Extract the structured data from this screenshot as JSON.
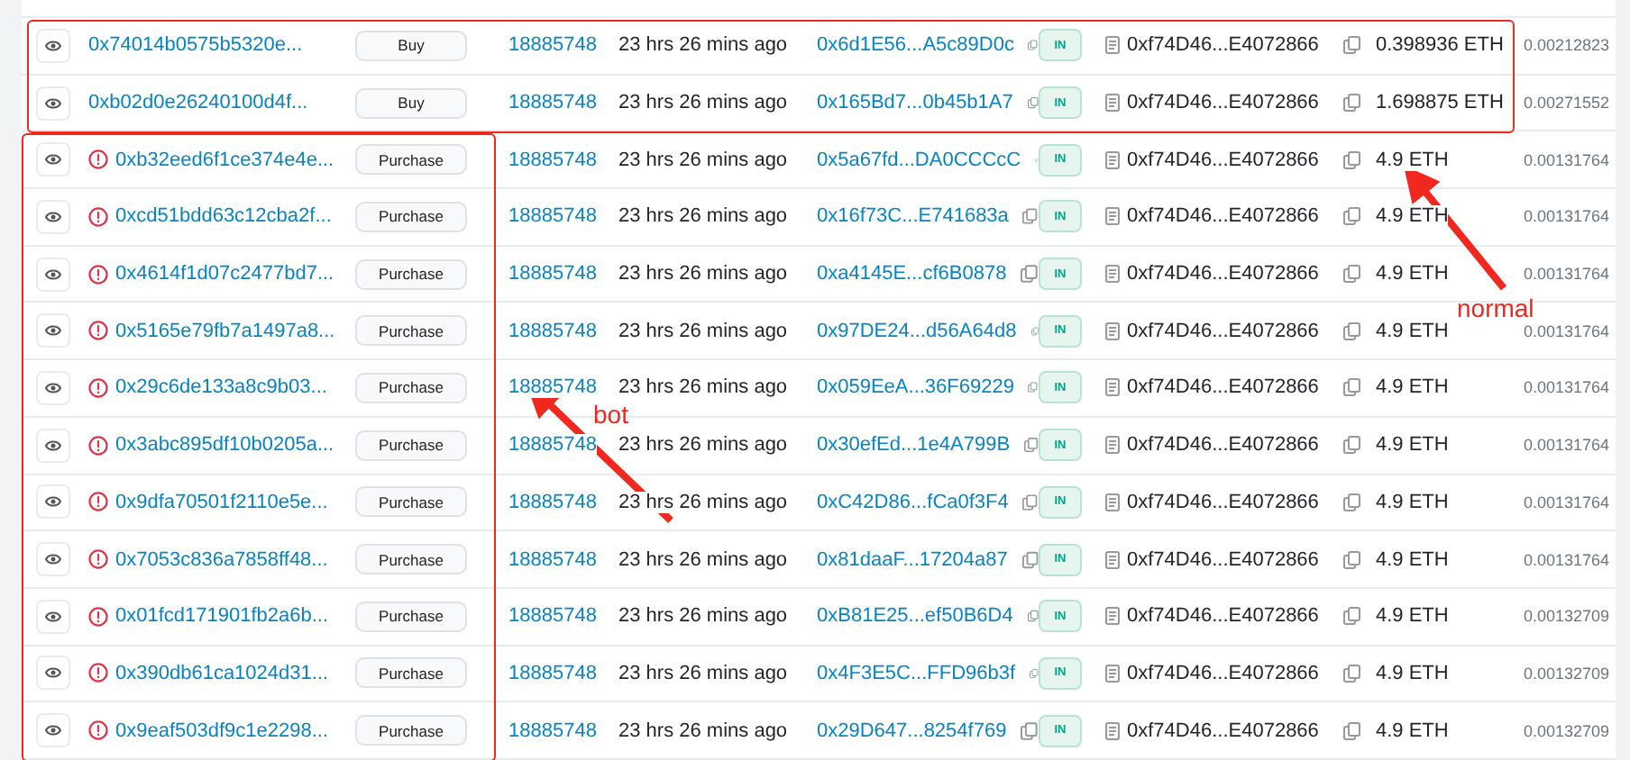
{
  "rows": [
    {
      "hash": "0x74014b0575b5320e...",
      "flagged": false,
      "method": "Buy",
      "block": "18885748",
      "age": "23 hrs 26 mins ago",
      "from": "0x6d1E56...A5c89D0c",
      "direction": "IN",
      "to": "0xf74D46...E4072866",
      "value": "0.398936 ETH",
      "fee": "0.00212823"
    },
    {
      "hash": "0xb02d0e26240100d4f...",
      "flagged": false,
      "method": "Buy",
      "block": "18885748",
      "age": "23 hrs 26 mins ago",
      "from": "0x165Bd7...0b45b1A7",
      "direction": "IN",
      "to": "0xf74D46...E4072866",
      "value": "1.698875 ETH",
      "fee": "0.00271552"
    },
    {
      "hash": "0xb32eed6f1ce374e4e...",
      "flagged": true,
      "method": "Purchase",
      "block": "18885748",
      "age": "23 hrs 26 mins ago",
      "from": "0x5a67fd...DA0CCCcC",
      "direction": "IN",
      "to": "0xf74D46...E4072866",
      "value": "4.9 ETH",
      "fee": "0.00131764"
    },
    {
      "hash": "0xcd51bdd63c12cba2f...",
      "flagged": true,
      "method": "Purchase",
      "block": "18885748",
      "age": "23 hrs 26 mins ago",
      "from": "0x16f73C...E741683a",
      "direction": "IN",
      "to": "0xf74D46...E4072866",
      "value": "4.9 ETH",
      "fee": "0.00131764"
    },
    {
      "hash": "0x4614f1d07c2477bd7...",
      "flagged": true,
      "method": "Purchase",
      "block": "18885748",
      "age": "23 hrs 26 mins ago",
      "from": "0xa4145E...cf6B0878",
      "direction": "IN",
      "to": "0xf74D46...E4072866",
      "value": "4.9 ETH",
      "fee": "0.00131764"
    },
    {
      "hash": "0x5165e79fb7a1497a8...",
      "flagged": true,
      "method": "Purchase",
      "block": "18885748",
      "age": "23 hrs 26 mins ago",
      "from": "0x97DE24...d56A64d8",
      "direction": "IN",
      "to": "0xf74D46...E4072866",
      "value": "4.9 ETH",
      "fee": "0.00131764"
    },
    {
      "hash": "0x29c6de133a8c9b03...",
      "flagged": true,
      "method": "Purchase",
      "block": "18885748",
      "age": "23 hrs 26 mins ago",
      "from": "0x059EeA...36F69229",
      "direction": "IN",
      "to": "0xf74D46...E4072866",
      "value": "4.9 ETH",
      "fee": "0.00131764"
    },
    {
      "hash": "0x3abc895df10b0205a...",
      "flagged": true,
      "method": "Purchase",
      "block": "18885748",
      "age": "23 hrs 26 mins ago",
      "from": "0x30efEd...1e4A799B",
      "direction": "IN",
      "to": "0xf74D46...E4072866",
      "value": "4.9 ETH",
      "fee": "0.00131764"
    },
    {
      "hash": "0x9dfa70501f2110e5e...",
      "flagged": true,
      "method": "Purchase",
      "block": "18885748",
      "age": "23 hrs 26 mins ago",
      "from": "0xC42D86...fCa0f3F4",
      "direction": "IN",
      "to": "0xf74D46...E4072866",
      "value": "4.9 ETH",
      "fee": "0.00131764"
    },
    {
      "hash": "0x7053c836a7858ff48...",
      "flagged": true,
      "method": "Purchase",
      "block": "18885748",
      "age": "23 hrs 26 mins ago",
      "from": "0x81daaF...17204a87",
      "direction": "IN",
      "to": "0xf74D46...E4072866",
      "value": "4.9 ETH",
      "fee": "0.00131764"
    },
    {
      "hash": "0x01fcd171901fb2a6b...",
      "flagged": true,
      "method": "Purchase",
      "block": "18885748",
      "age": "23 hrs 26 mins ago",
      "from": "0xB81E25...ef50B6D4",
      "direction": "IN",
      "to": "0xf74D46...E4072866",
      "value": "4.9 ETH",
      "fee": "0.00132709"
    },
    {
      "hash": "0x390db61ca1024d31...",
      "flagged": true,
      "method": "Purchase",
      "block": "18885748",
      "age": "23 hrs 26 mins ago",
      "from": "0x4F3E5C...FFD96b3f",
      "direction": "IN",
      "to": "0xf74D46...E4072866",
      "value": "4.9 ETH",
      "fee": "0.00132709"
    },
    {
      "hash": "0x9eaf503df9c1e2298...",
      "flagged": true,
      "method": "Purchase",
      "block": "18885748",
      "age": "23 hrs 26 mins ago",
      "from": "0x29D647...8254f769",
      "direction": "IN",
      "to": "0xf74D46...E4072866",
      "value": "4.9 ETH",
      "fee": "0.00132709"
    }
  ],
  "annotations": [
    {
      "label": "normal"
    },
    {
      "label": "bot"
    }
  ]
}
